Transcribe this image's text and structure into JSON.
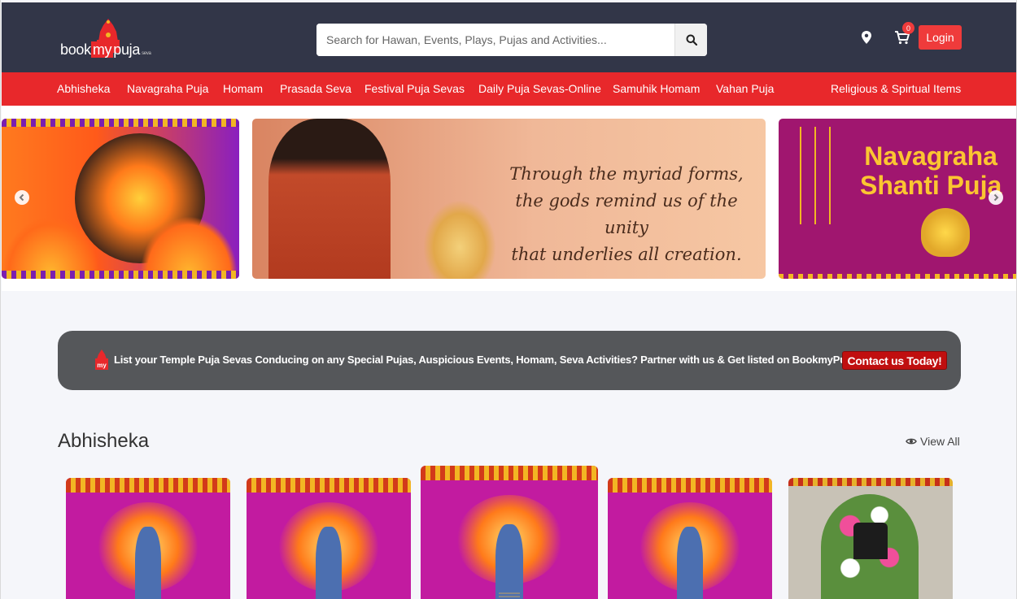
{
  "header": {
    "logo": {
      "word1": "book",
      "word2": "my",
      "word3": "puja",
      "sub": "seva"
    },
    "search": {
      "placeholder": "Search for Hawan, Events, Plays, Pujas and Activities..."
    },
    "cart_count": "0",
    "login_label": "Login"
  },
  "nav": {
    "items": [
      "Abhisheka",
      "Navagraha Puja",
      "Homam",
      "Prasada Seva",
      "Festival Puja Sevas",
      "Daily Puja Sevas-Online",
      "Samuhik Homam",
      "Vahan Puja"
    ],
    "right_item": "Religious & Spirtual Items"
  },
  "carousel": {
    "quote_line1": "Through the myriad forms,",
    "quote_line2": "the gods remind us of the unity",
    "quote_line3": "that underlies all creation.",
    "slide3_line1": "Navagraha",
    "slide3_line2": "Shanti Puja",
    "prev_icon": "chevron-left-icon",
    "next_icon": "chevron-right-icon"
  },
  "partner": {
    "text": "List your Temple Puja Sevas Conducing on any Special Pujas, Auspicious Events, Homam, Seva Activities? Partner with us & Get listed on BookmyPujaSeva.",
    "cta": "Contact us Today!"
  },
  "section": {
    "title": "Abhisheka",
    "view_all": "View All"
  },
  "colors": {
    "header_bg": "#323648",
    "nav_bg": "#e8282b",
    "login_bg": "#ef3b3b",
    "partner_bg": "#55575a",
    "cta_bg": "#c00f0f"
  }
}
